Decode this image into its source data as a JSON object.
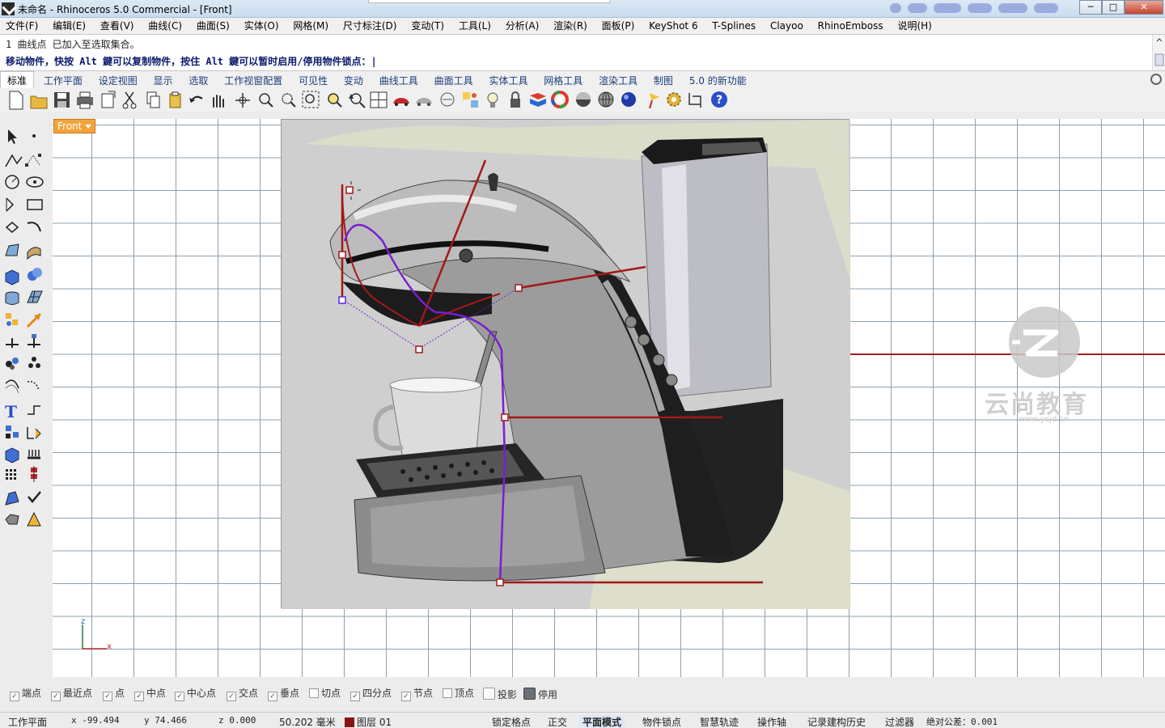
{
  "window": {
    "title": "未命名 - Rhinoceros 5.0 Commercial - [Front]",
    "min_glyph": "─",
    "max_glyph": "□",
    "close_glyph": "✕"
  },
  "menu": [
    "文件(F)",
    "编辑(E)",
    "查看(V)",
    "曲线(C)",
    "曲面(S)",
    "实体(O)",
    "网格(M)",
    "尺寸标注(D)",
    "变动(T)",
    "工具(L)",
    "分析(A)",
    "渲染(R)",
    "面板(P)",
    "KeyShot 6",
    "T-Splines",
    "Clayoo",
    "RhinoEmboss",
    "说明(H)"
  ],
  "command": {
    "history": "1 曲线点 已加入至选取集合。",
    "prompt": "移动物件，快按 Alt 鍵可以复制物件，按住 Alt 鍵可以暂时启用/停用物件锁点：|"
  },
  "tabs": [
    "标准",
    "工作平面",
    "设定视图",
    "显示",
    "选取",
    "工作视窗配置",
    "可见性",
    "变动",
    "曲线工具",
    "曲面工具",
    "实体工具",
    "网格工具",
    "渲染工具",
    "制图",
    "5.0 的新功能"
  ],
  "viewport": {
    "label": "Front",
    "axis_z": "z",
    "axis_x": "x"
  },
  "watermark": {
    "text": "云尚教育",
    "url": "www.ycjd.cn"
  },
  "osnaps": [
    {
      "label": "端点",
      "checked": true
    },
    {
      "label": "最近点",
      "checked": true
    },
    {
      "label": "点",
      "checked": true
    },
    {
      "label": "中点",
      "checked": true
    },
    {
      "label": "中心点",
      "checked": true
    },
    {
      "label": "交点",
      "checked": true
    },
    {
      "label": "垂点",
      "checked": true
    },
    {
      "label": "切点",
      "checked": false
    },
    {
      "label": "四分点",
      "checked": true
    },
    {
      "label": "节点",
      "checked": true
    },
    {
      "label": "顶点",
      "checked": false
    },
    {
      "label": "投影",
      "checked": false
    },
    {
      "label": "停用",
      "checked": false
    }
  ],
  "status": {
    "cplane": "工作平面",
    "x": "x -99.494",
    "y": "y 74.466",
    "z": "z 0.000",
    "dist": "50.202 毫米",
    "layer": "图层 01",
    "grid_snap": "锁定格点",
    "ortho": "正交",
    "planar": "平面模式",
    "osnap": "物件锁点",
    "smarttrack": "智慧轨迹",
    "gumball": "操作轴",
    "history": "记录建构历史",
    "filter": "过滤器",
    "tolerance": "绝对公差：0.001"
  },
  "colors": {
    "curve_red": "#a31818",
    "curve_purple": "#7a1fd0",
    "viewport_label": "#f3a33b",
    "grid": "#8ea0ae"
  },
  "icons": {
    "toolbar": [
      "new-file-icon",
      "open-folder-icon",
      "save-icon",
      "print-icon",
      "import-icon",
      "cut-icon",
      "copy-icon",
      "paste-icon",
      "undo-icon",
      "pan-hand-icon",
      "rotate-view-icon",
      "zoom-window-icon",
      "zoom-dynamic-icon",
      "zoom-extents-icon",
      "zoom-selected-icon",
      "redo-view-icon",
      "four-viewports-icon",
      "car-render-icon",
      "shaded-mode-icon",
      "arrow-icon",
      "point-grid-icon",
      "light-bulb-icon",
      "lock-icon",
      "layer-icon",
      "color-wheel-icon",
      "render-sphere-icon",
      "mesh-sphere-icon",
      "blue-sphere-icon",
      "flag-icon",
      "gear-icon",
      "crop-icon",
      "help-icon"
    ]
  }
}
